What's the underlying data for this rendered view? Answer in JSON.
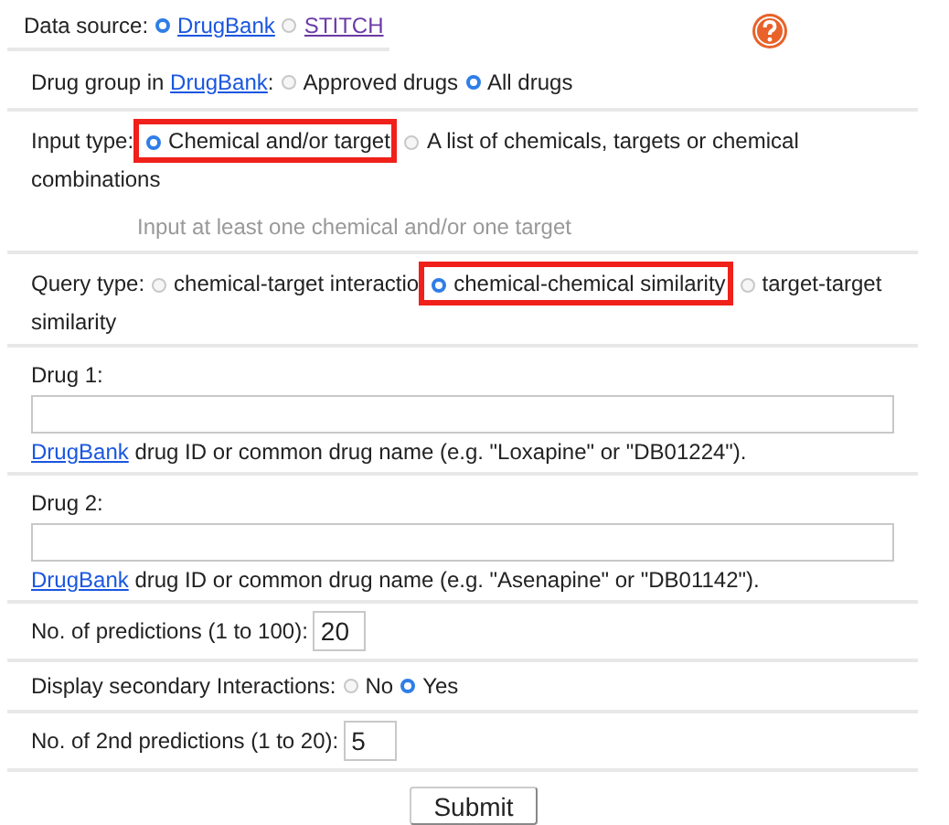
{
  "data_source": {
    "label": "Data source:",
    "options": [
      {
        "label": "DrugBank",
        "selected": true,
        "visited": false
      },
      {
        "label": "STITCH",
        "selected": false,
        "visited": true
      }
    ]
  },
  "drug_group": {
    "label_prefix": "Drug group in ",
    "label_link": "DrugBank",
    "label_suffix": ":",
    "options": [
      {
        "label": "Approved drugs",
        "selected": false,
        "highlighted": false
      },
      {
        "label": "All drugs",
        "selected": true,
        "highlighted": false
      }
    ]
  },
  "input_type": {
    "label": "Input type:",
    "options": [
      {
        "label": "Chemical and/or target",
        "selected": true,
        "highlighted": true
      },
      {
        "label_lines": [
          "A list of chemicals, targets or chemical",
          "combinations"
        ],
        "selected": false,
        "highlighted": false
      }
    ],
    "hint": "Input at least one chemical and/or one target"
  },
  "query_type": {
    "label": "Query type:",
    "options": [
      {
        "label": "chemical-target interactio",
        "selected": false,
        "highlighted": false
      },
      {
        "label": "chemical-chemical similarity",
        "selected": true,
        "highlighted": true
      },
      {
        "label_lines": [
          "target-target",
          "similarity"
        ],
        "selected": false,
        "highlighted": false
      }
    ]
  },
  "drugs": [
    {
      "label": "Drug 1:",
      "help_link": "DrugBank",
      "help_text": " drug ID or common drug name (e.g. \"Loxapine\" or \"DB01224\")."
    },
    {
      "label": "Drug 2:",
      "help_link": "DrugBank",
      "help_text": " drug ID or common drug name (e.g. \"Asenapine\" or \"DB01142\")."
    }
  ],
  "predictions": {
    "label": "No. of predictions (1 to 100):",
    "value": "20"
  },
  "secondary": {
    "label": "Display secondary Interactions:",
    "options": [
      {
        "label": "No",
        "selected": false,
        "highlighted": false
      },
      {
        "label": "Yes",
        "selected": true,
        "highlighted": false
      }
    ]
  },
  "second_predictions": {
    "label": "No. of 2nd predictions (1 to 20):",
    "value": "5"
  },
  "submit": "Submit"
}
